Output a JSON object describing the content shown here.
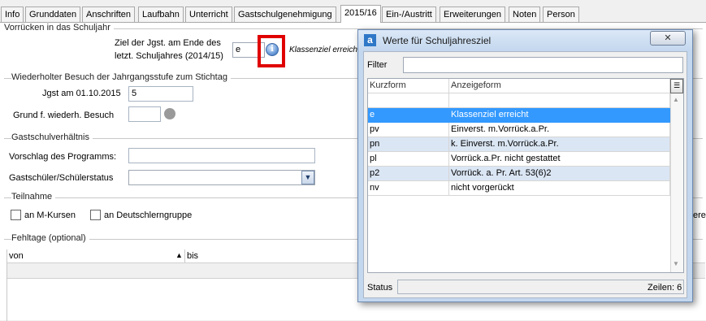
{
  "tabs": [
    {
      "label": "Info",
      "active": false
    },
    {
      "label": "Grunddaten",
      "active": false
    },
    {
      "label": "Anschriften",
      "active": false
    },
    {
      "label": "Laufbahn",
      "active": false
    },
    {
      "label": "Unterricht",
      "active": false
    },
    {
      "label": "Gastschulgenehmigung",
      "active": false
    },
    {
      "label": "2015/16",
      "active": true
    },
    {
      "label": "Ein-/Austritt",
      "active": false
    },
    {
      "label": "Erweiterungen",
      "active": false
    },
    {
      "label": "Noten",
      "active": false
    },
    {
      "label": "Person",
      "active": false
    }
  ],
  "vorruecken": {
    "section_title": "Vorrücken in das Schuljahr",
    "ziel_label_line1": "Ziel der Jgst. am Ende des",
    "ziel_label_line2": "letzt. Schuljahres (2014/15)",
    "ziel_value": "e",
    "ziel_text": "Klassenziel erreicht"
  },
  "wiederholter": {
    "section_title": "Wiederholter Besuch der Jahrgangsstufe zum Stichtag",
    "jgst_label": "Jgst am 01.10.2015",
    "jgst_value": "5",
    "grund_label": "Grund f. wiederh. Besuch",
    "grund_value": ""
  },
  "gastschul": {
    "section_title": "Gastschulverhältnis",
    "vorschlag_label": "Vorschlag des Programms:",
    "vorschlag_value": "",
    "status_label": "Gastschüler/Schülerstatus",
    "status_value": ""
  },
  "teilnahme": {
    "section_title": "Teilnahme",
    "m_kurse_label": "an M-Kursen",
    "m_kurse_checked": false,
    "deutsch_label": "an Deutschlerngruppe",
    "deutsch_checked": false,
    "clipped_text": "ere"
  },
  "fehltage": {
    "section_title": "Fehltage (optional)",
    "col_von": "von",
    "col_bis": "bis"
  },
  "dialog": {
    "title": "Werte für Schuljahresziel",
    "close_label": "✕",
    "filter_label": "Filter",
    "filter_value": "",
    "col_kurzform": "Kurzform",
    "col_anzeigeform": "Anzeigeform",
    "rows": [
      {
        "kurz": "e",
        "anzeige": "Klassenziel erreicht"
      },
      {
        "kurz": "pv",
        "anzeige": "Einverst. m.Vorrück.a.Pr."
      },
      {
        "kurz": "pn",
        "anzeige": "k. Einverst. m.Vorrück.a.Pr."
      },
      {
        "kurz": "pl",
        "anzeige": "Vorrück.a.Pr. nicht gestattet"
      },
      {
        "kurz": "p2",
        "anzeige": "Vorrück. a. Pr. Art. 53(6)2"
      },
      {
        "kurz": "nv",
        "anzeige": "nicht vorgerückt"
      }
    ],
    "selected_index": 0,
    "status_label": "Status",
    "count_text": "Zeilen: 6"
  },
  "colors": {
    "selection": "#3399ff",
    "alt_row": "#dbe6f4",
    "highlight": "#e00000"
  },
  "icons": [
    "info-icon",
    "combo-arrow-icon",
    "column-chooser-icon",
    "app-logo-icon",
    "close-icon"
  ]
}
